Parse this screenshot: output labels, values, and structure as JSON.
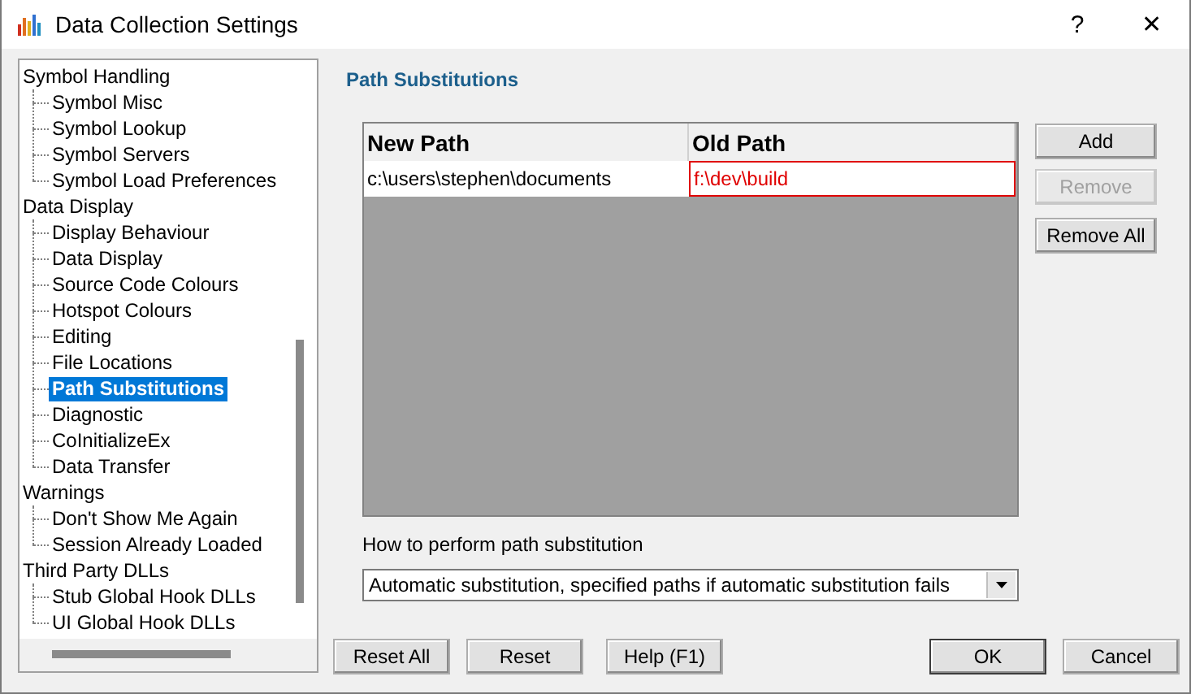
{
  "window": {
    "title": "Data Collection Settings",
    "help_button": "?",
    "close_button": "✕"
  },
  "tree": [
    {
      "label": "Symbol Handling",
      "selected": false,
      "children": [
        {
          "label": "Symbol Misc",
          "selected": false
        },
        {
          "label": "Symbol Lookup",
          "selected": false
        },
        {
          "label": "Symbol Servers",
          "selected": false
        },
        {
          "label": "Symbol Load Preferences",
          "selected": false
        }
      ]
    },
    {
      "label": "Data Display",
      "selected": false,
      "children": [
        {
          "label": "Display Behaviour",
          "selected": false
        },
        {
          "label": "Data Display",
          "selected": false
        },
        {
          "label": "Source Code Colours",
          "selected": false
        },
        {
          "label": "Hotspot Colours",
          "selected": false
        },
        {
          "label": "Editing",
          "selected": false
        },
        {
          "label": "File Locations",
          "selected": false
        },
        {
          "label": "Path Substitutions",
          "selected": true
        },
        {
          "label": "Diagnostic",
          "selected": false
        },
        {
          "label": "CoInitializeEx",
          "selected": false
        },
        {
          "label": "Data Transfer",
          "selected": false
        }
      ]
    },
    {
      "label": "Warnings",
      "selected": false,
      "children": [
        {
          "label": "Don't Show Me Again",
          "selected": false
        },
        {
          "label": "Session Already Loaded",
          "selected": false
        }
      ]
    },
    {
      "label": "Third Party DLLs",
      "selected": false,
      "children": [
        {
          "label": "Stub Global Hook DLLs",
          "selected": false
        },
        {
          "label": "UI Global Hook DLLs",
          "selected": false
        }
      ]
    }
  ],
  "page": {
    "heading": "Path Substitutions",
    "table": {
      "columns": [
        "New Path",
        "Old Path"
      ],
      "rows": [
        {
          "cells": [
            {
              "text": "c:\\users\\stephen\\documents",
              "invalid": false
            },
            {
              "text": "f:\\dev\\build",
              "invalid": true
            }
          ]
        }
      ]
    },
    "side_buttons": [
      {
        "label": "Add",
        "disabled": false
      },
      {
        "label": "Remove",
        "disabled": true
      },
      {
        "label": "Remove All",
        "disabled": false
      }
    ],
    "mode": {
      "label": "How to perform path substitution",
      "value": "Automatic substitution, specified paths if automatic substitution fails"
    }
  },
  "footer": {
    "left_buttons": [
      {
        "label": "Reset All",
        "default": false
      },
      {
        "label": "Reset",
        "default": false
      },
      {
        "label": "Help (F1)",
        "default": false
      }
    ],
    "right_buttons": [
      {
        "label": "OK",
        "default": true
      },
      {
        "label": "Cancel",
        "default": false
      }
    ]
  }
}
